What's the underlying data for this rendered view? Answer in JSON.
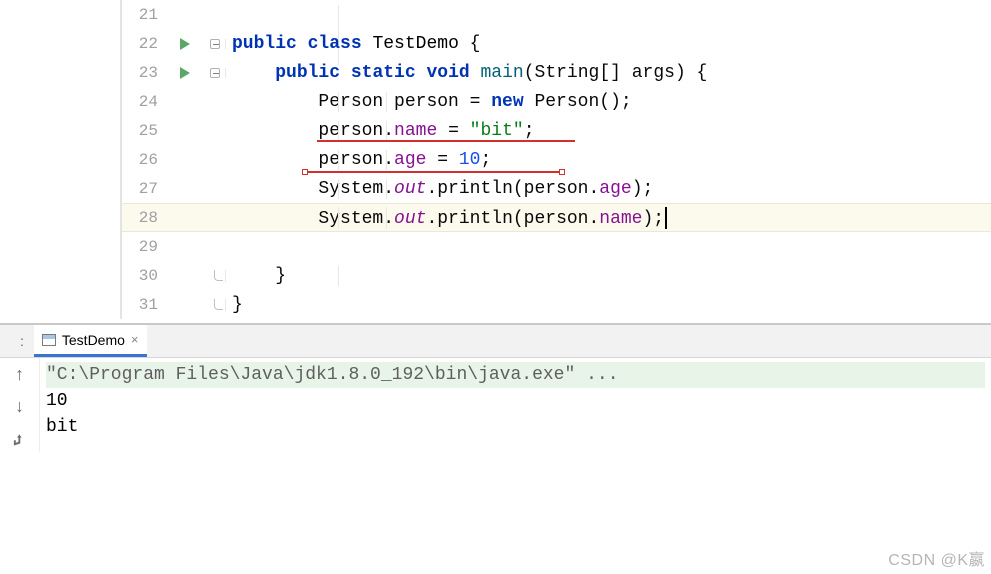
{
  "code": {
    "lines": {
      "21": "21",
      "22": "22",
      "23": "23",
      "24": "24",
      "25": "25",
      "26": "26",
      "27": "27",
      "28": "28",
      "29": "29",
      "30": "30",
      "31": "31"
    },
    "l22": {
      "kw1": "public",
      "kw2": "class",
      "cls": "TestDemo",
      "brace": " {"
    },
    "l23": {
      "kw1": "public",
      "kw2": "static",
      "kw3": "void",
      "mtd": "main",
      "params": "(String[] args) {"
    },
    "l24": {
      "t1": "Person person = ",
      "kw": "new",
      "t2": " Person();"
    },
    "l25": {
      "obj": "person.",
      "fld": "name",
      "eq": " = ",
      "str": "\"bit\"",
      "semi": ";"
    },
    "l26": {
      "obj": "person.",
      "fld": "age",
      "eq": " = ",
      "num": "10",
      "semi": ";"
    },
    "l27": {
      "t1": "System.",
      "out": "out",
      "t2": ".println(person.",
      "fld": "age",
      "t3": ");"
    },
    "l28": {
      "t1": "System.",
      "out": "out",
      "t2": ".println(person.",
      "fld": "name",
      "t3": ");"
    },
    "l30": {
      "brace": "}"
    },
    "l31": {
      "brace": "}"
    }
  },
  "run": {
    "tab_name": "TestDemo",
    "label": ":"
  },
  "console": {
    "command": "\"C:\\Program Files\\Java\\jdk1.8.0_192\\bin\\java.exe\" ...",
    "out1": "10",
    "out2": "bit"
  },
  "watermark": "CSDN @K嬴"
}
